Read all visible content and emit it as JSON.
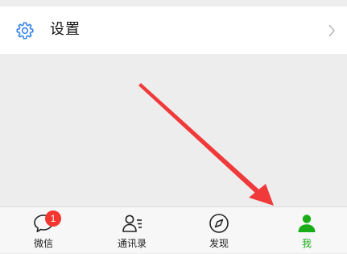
{
  "settings": {
    "label": "设置",
    "icon": "gear-icon",
    "icon_color": "#2b7de9"
  },
  "tabbar": {
    "active_color": "#1aad19",
    "tabs": [
      {
        "label": "微信",
        "icon": "chat-bubble-icon",
        "badge": "1"
      },
      {
        "label": "通讯录",
        "icon": "contacts-icon"
      },
      {
        "label": "发现",
        "icon": "compass-icon"
      },
      {
        "label": "我",
        "icon": "person-icon",
        "active": true
      }
    ]
  },
  "annotation": {
    "arrow_color": "#f0393a"
  }
}
